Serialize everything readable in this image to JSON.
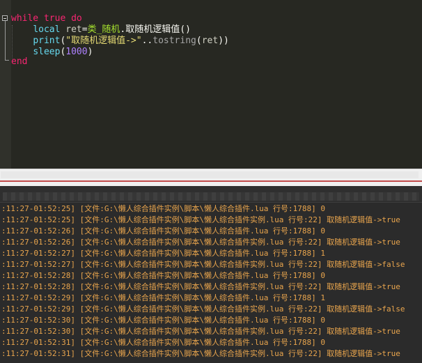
{
  "editor": {
    "lines": [
      {
        "parts": [
          {
            "t": "while",
            "c": "kw"
          },
          {
            "t": " ",
            "c": "plain"
          },
          {
            "t": "true",
            "c": "kw"
          },
          {
            "t": " ",
            "c": "plain"
          },
          {
            "t": "do",
            "c": "kw"
          }
        ]
      },
      {
        "parts": [
          {
            "t": "    ",
            "c": "plain"
          },
          {
            "t": "local",
            "c": "kw2"
          },
          {
            "t": " ",
            "c": "plain"
          },
          {
            "t": "ret",
            "c": "var"
          },
          {
            "t": "=",
            "c": "plain"
          },
          {
            "t": "类_随机",
            "c": "cn"
          },
          {
            "t": ".",
            "c": "plain"
          },
          {
            "t": "取随机逻辑值",
            "c": "plain"
          },
          {
            "t": "()",
            "c": "plain"
          }
        ]
      },
      {
        "parts": [
          {
            "t": "    ",
            "c": "plain"
          },
          {
            "t": "print",
            "c": "kw2"
          },
          {
            "t": "(",
            "c": "plain"
          },
          {
            "t": "\"取随机逻辑值->\"",
            "c": "str"
          },
          {
            "t": "..",
            "c": "plain"
          },
          {
            "t": "tostring",
            "c": "fn"
          },
          {
            "t": "(",
            "c": "plain"
          },
          {
            "t": "ret",
            "c": "var"
          },
          {
            "t": "))",
            "c": "plain"
          }
        ]
      },
      {
        "parts": [
          {
            "t": "    ",
            "c": "plain"
          },
          {
            "t": "sleep",
            "c": "kw2"
          },
          {
            "t": "(",
            "c": "plain"
          },
          {
            "t": "1000",
            "c": "num"
          },
          {
            "t": ")",
            "c": "plain"
          }
        ]
      },
      {
        "parts": [
          {
            "t": "end",
            "c": "kw"
          }
        ]
      }
    ]
  },
  "output": {
    "lines": [
      ":11:27-01:52:25] [文件:G:\\懒人综合插件实例\\脚本\\懒人综合插件.lua 行号:1788] 0",
      ":11:27-01:52:25] [文件:G:\\懒人综合插件实例\\脚本\\懒人综合插件实例.lua 行号:22] 取随机逻辑值->true",
      ":11:27-01:52:26] [文件:G:\\懒人综合插件实例\\脚本\\懒人综合插件.lua 行号:1788] 0",
      ":11:27-01:52:26] [文件:G:\\懒人综合插件实例\\脚本\\懒人综合插件实例.lua 行号:22] 取随机逻辑值->true",
      ":11:27-01:52:27] [文件:G:\\懒人综合插件实例\\脚本\\懒人综合插件.lua 行号:1788] 1",
      ":11:27-01:52:27] [文件:G:\\懒人综合插件实例\\脚本\\懒人综合插件实例.lua 行号:22] 取随机逻辑值->false",
      ":11:27-01:52:28] [文件:G:\\懒人综合插件实例\\脚本\\懒人综合插件.lua 行号:1788] 0",
      ":11:27-01:52:28] [文件:G:\\懒人综合插件实例\\脚本\\懒人综合插件实例.lua 行号:22] 取随机逻辑值->true",
      ":11:27-01:52:29] [文件:G:\\懒人综合插件实例\\脚本\\懒人综合插件.lua 行号:1788] 1",
      ":11:27-01:52:29] [文件:G:\\懒人综合插件实例\\脚本\\懒人综合插件实例.lua 行号:22] 取随机逻辑值->false",
      ":11:27-01:52:30] [文件:G:\\懒人综合插件实例\\脚本\\懒人综合插件.lua 行号:1788] 0",
      ":11:27-01:52:30] [文件:G:\\懒人综合插件实例\\脚本\\懒人综合插件实例.lua 行号:22] 取随机逻辑值->true",
      ":11:27-01:52:31] [文件:G:\\懒人综合插件实例\\脚本\\懒人综合插件.lua 行号:1788] 0",
      ":11:27-01:52:31] [文件:G:\\懒人综合插件实例\\脚本\\懒人综合插件实例.lua 行号:22] 取随机逻辑值->true"
    ]
  },
  "colors": {
    "editor_bg": "#272822",
    "keyword": "#f92672",
    "builtin": "#66d9ef",
    "string": "#e6db74",
    "number": "#ae81ff",
    "output_bg": "#2b2b2b",
    "output_text": "#e9a54d"
  },
  "icons": {
    "fold": "fold-minus-icon"
  }
}
